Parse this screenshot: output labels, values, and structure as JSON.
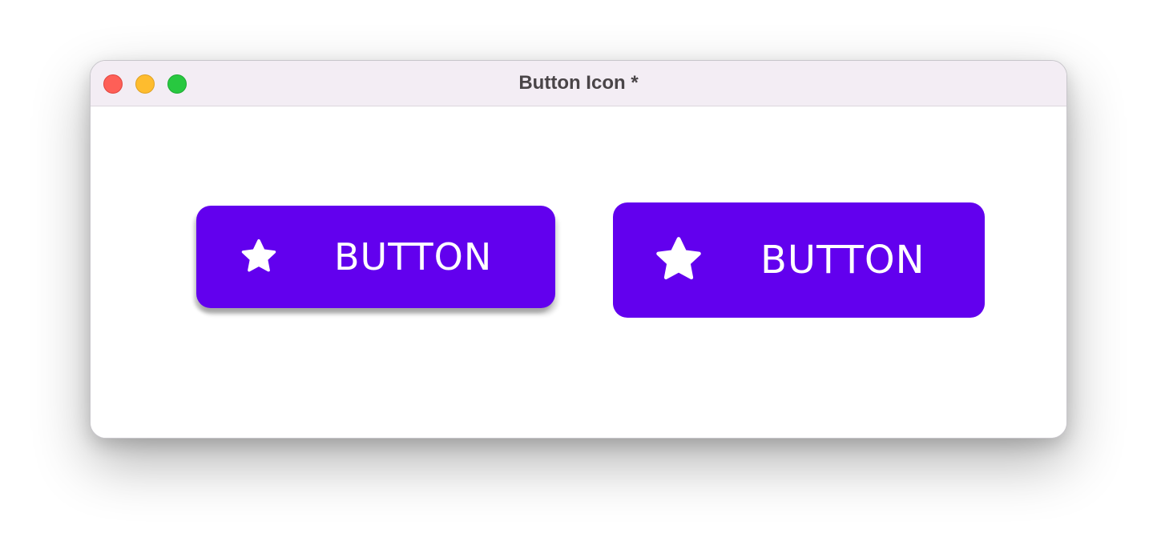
{
  "window": {
    "title": "Button Icon *"
  },
  "buttons": [
    {
      "label": "BUTTON",
      "icon": "star-icon"
    },
    {
      "label": "BUTTON",
      "icon": "star-icon"
    }
  ],
  "colors": {
    "button_background": "#6200ee",
    "button_text": "#ffffff",
    "titlebar": "#f3edf4",
    "close": "#fe5f57",
    "minimize": "#febc2e",
    "maximize": "#28c840"
  }
}
